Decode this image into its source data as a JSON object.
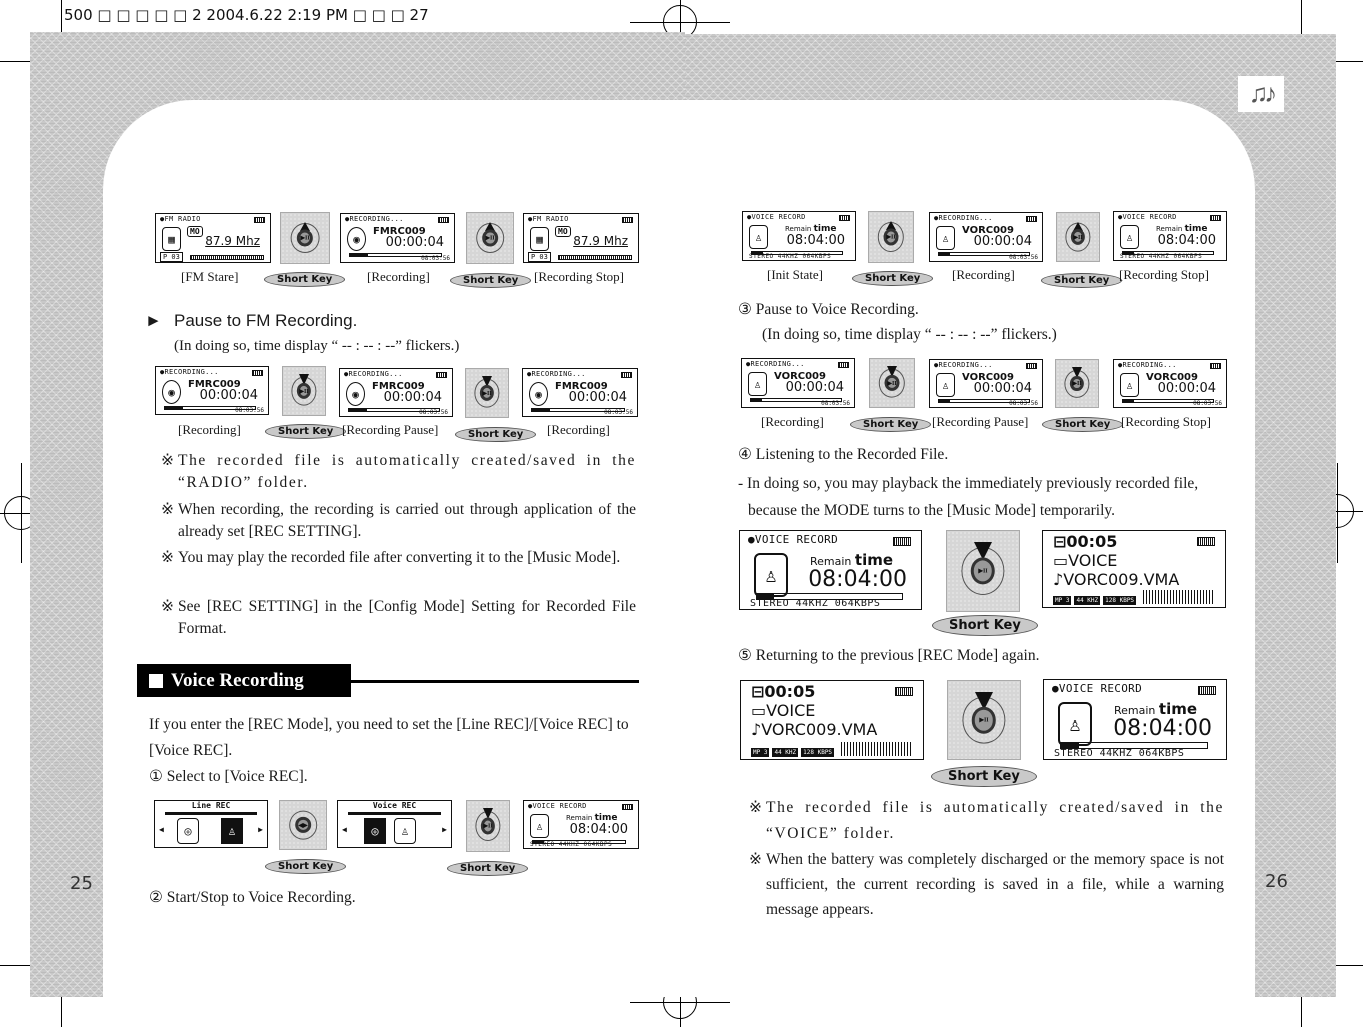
{
  "print_header": "500 □ □  □ □ □ 2  2004.6.22 2:19 PM □ □ □ 27",
  "page_numbers": {
    "left": "25",
    "right": "26"
  },
  "decor": {
    "music_notes_icon": "♫♪"
  },
  "left_page": {
    "fm_sequence_1": {
      "screens": [
        {
          "top": "●FM RADIO",
          "mode": "MO",
          "frequency": "87.9 Mhz",
          "preset": "P 03"
        },
        {
          "top": "●RECORDING...",
          "file": "FMRC009",
          "time": "00:00:04",
          "remaining": "08:03:56",
          "progress": 0.2
        },
        {
          "top": "●FM RADIO",
          "mode": "MO",
          "frequency": "87.9 Mhz",
          "preset": "P 03"
        }
      ],
      "captions": [
        "[FM Stare]",
        "[Recording]",
        "[Recording Stop]"
      ],
      "short_key_labels": [
        "Short Key",
        "Short Key"
      ]
    },
    "pause_fm": {
      "bullet": "►",
      "title": "Pause to FM Recording.",
      "subtitle": "(In doing so, time display “ --  : -- : --”  flickers.)"
    },
    "fm_sequence_2": {
      "screens": [
        {
          "top": "●RECORDING...",
          "file": "FMRC009",
          "time": "00:00:04",
          "remaining": "08:03:56",
          "progress": 0.2
        },
        {
          "top": "●RECORDING...",
          "file": "FMRC009",
          "time": "00:00:04",
          "remaining": "08:03:56",
          "progress": 0.2
        },
        {
          "top": "●RECORDING...",
          "file": "FMRC009",
          "time": "00:00:04",
          "remaining": "08:03:56",
          "progress": 0.2
        }
      ],
      "captions": [
        "[Recording]",
        "[Recording Pause]",
        "[Recording]"
      ],
      "short_key_labels": [
        "Short Key",
        "Short Key"
      ]
    },
    "notes": [
      {
        "mark": "※",
        "text": "The recorded file is automatically created/saved in the “RADIO” folder."
      },
      {
        "mark": "※",
        "text": "When recording, the recording is carried out through application of the already set [REC SETTING]."
      },
      {
        "mark": "※",
        "text": "You may play the recorded file after converting it to the [Music Mode]."
      },
      {
        "mark": "※",
        "text": "See [REC SETTING] in the [Config Mode] Setting for Recorded File Format."
      }
    ],
    "voice_section": {
      "heading": "Voice Recording",
      "intro": "If you enter the [REC Mode], you need to set the [Line REC]/[Voice REC] to [Voice REC].",
      "step1": "① Select to [Voice REC].",
      "menu_screens": [
        {
          "title": "Line REC"
        },
        {
          "title": "Voice REC"
        }
      ],
      "result_screen": {
        "top": "●VOICE RECORD",
        "remain_label": "Remain",
        "remain_bold": "time",
        "time": "08:04:00",
        "stereo": "STEREO  44KHZ  064KBPS",
        "progress": 0.12
      },
      "short_key_labels": [
        "Short Key",
        "Short Key"
      ],
      "step2": "② Start/Stop to Voice Recording."
    }
  },
  "right_page": {
    "voice_sequence_1": {
      "screens": [
        {
          "type": "voice",
          "top": "●VOICE RECORD",
          "remain_label": "Remain",
          "remain_bold": "time",
          "time": "08:04:00",
          "stereo": "STEREO  44KHZ  064KBPS",
          "progress": 0.12
        },
        {
          "type": "rec",
          "top": "●RECORDING...",
          "file": "VORC009",
          "time": "00:00:04",
          "remaining": "08:03:56",
          "progress": 0.12
        },
        {
          "type": "voice",
          "top": "●VOICE RECORD",
          "remain_label": "Remain",
          "remain_bold": "time",
          "time": "08:04:00",
          "stereo": "STEREO  44KHZ  064KBPS",
          "progress": 0.12
        }
      ],
      "captions": [
        "[Init State]",
        "[Recording]",
        "[Recording Stop]"
      ],
      "short_key_labels": [
        "Short Key",
        "Short Key"
      ]
    },
    "step3": {
      "title": "③ Pause to Voice Recording.",
      "subtitle": "(In doing so, time display “ --  : -- : --”  flickers.)"
    },
    "voice_sequence_2": {
      "screens": [
        {
          "top": "●RECORDING...",
          "file": "VORC009",
          "time": "00:00:04",
          "remaining": "08:03:56",
          "progress": 0.12
        },
        {
          "top": "●RECORDING...",
          "file": "VORC009",
          "time": "00:00:04",
          "remaining": "08:03:56",
          "progress": 0.12
        },
        {
          "top": "●RECORDING...",
          "file": "VORC009",
          "time": "00:00:04",
          "remaining": "08:03:56",
          "progress": 0.12
        }
      ],
      "captions": [
        "[Recording]",
        "[Recording Pause]",
        "[Recording Stop]"
      ],
      "short_key_labels": [
        "Short Key",
        "Short Key"
      ]
    },
    "step4": {
      "title": "④ Listening to the Recorded File.",
      "body": "- In doing so, you may playback the immediately previously recorded file, because the MODE turns to the [Music Mode] temporarily."
    },
    "listen_sequence": {
      "voice_screen": {
        "top": "●VOICE RECORD",
        "remain_label": "Remain",
        "remain_bold": "time",
        "time": "08:04:00",
        "stereo": "STEREO  44KHZ  064KBPS",
        "progress": 0.12
      },
      "player_screen": {
        "elapsed": "00:05",
        "folder": "VOICE",
        "file": "VORC009.VMA",
        "badges": [
          "MP 3",
          "44 KHZ",
          "128 KBPS"
        ]
      },
      "short_key_label": "Short Key"
    },
    "step5": {
      "title": "⑤ Returning to the previous [REC Mode] again."
    },
    "return_sequence": {
      "player_screen": {
        "elapsed": "00:05",
        "folder": "VOICE",
        "file": "VORC009.VMA",
        "badges": [
          "MP 3",
          "44 KHZ",
          "128 KBPS"
        ]
      },
      "voice_screen": {
        "top": "●VOICE RECORD",
        "remain_label": "Remain",
        "remain_bold": "time",
        "time": "08:04:00",
        "stereo": "STEREO  44KHZ  064KBPS",
        "progress": 0.12
      },
      "short_key_label": "Short Key"
    },
    "notes": [
      {
        "mark": "※",
        "text": "The recorded file is automatically created/saved in the “VOICE” folder."
      },
      {
        "mark": "※",
        "text": "When the battery was completely discharged or the memory space is not sufficient, the current recording is saved in a file, while a warning message appears."
      }
    ]
  }
}
